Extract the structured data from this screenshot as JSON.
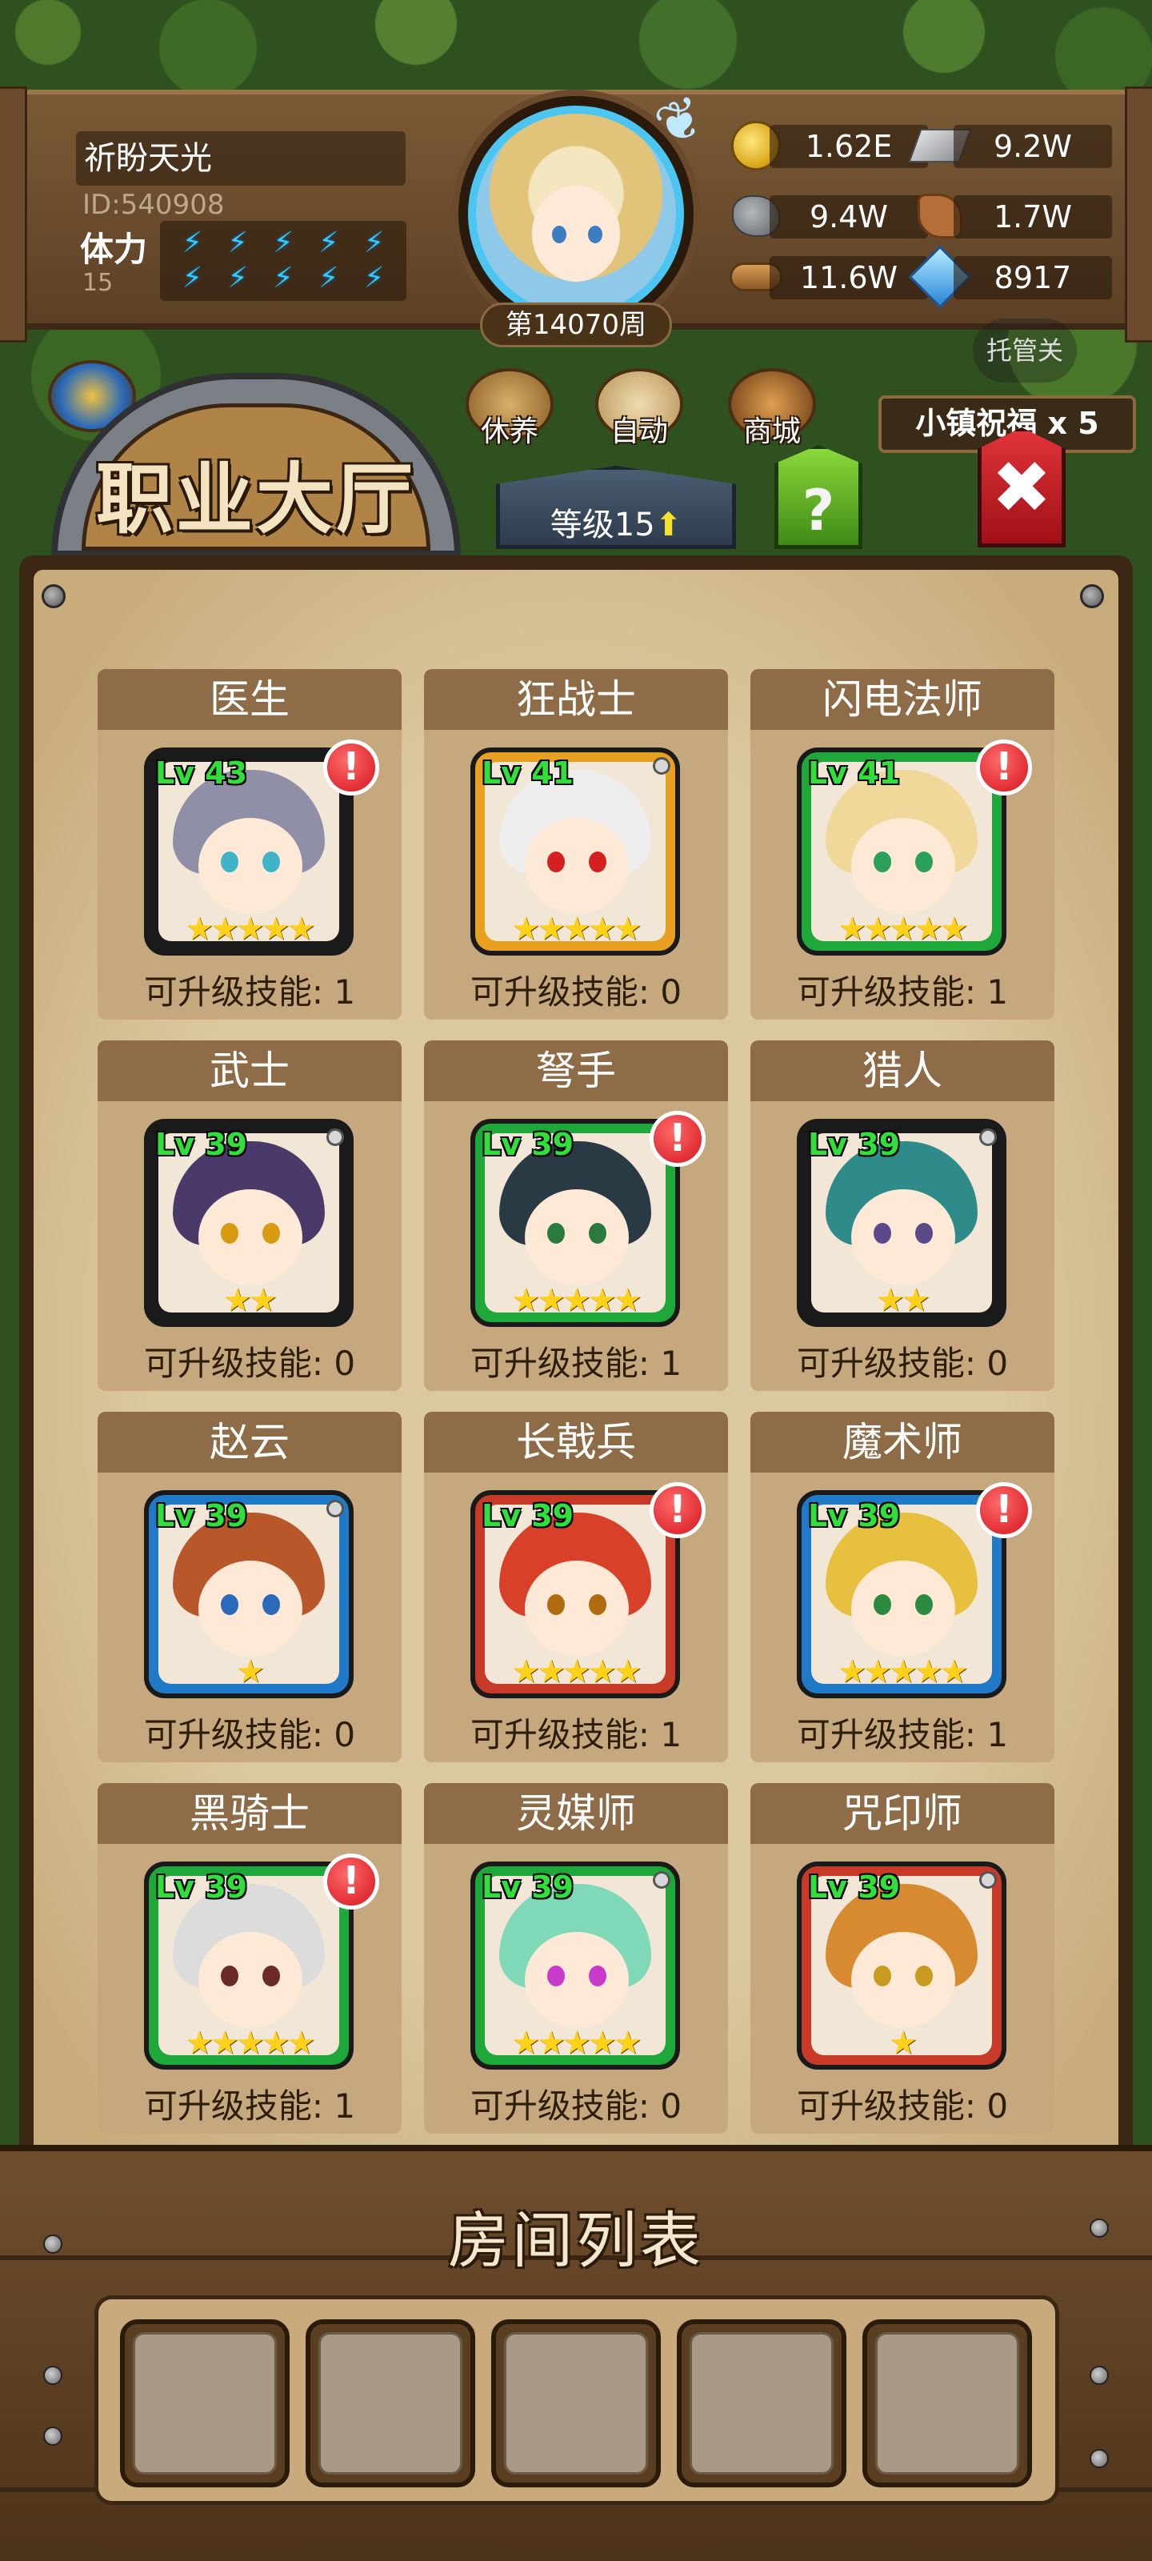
{
  "player": {
    "name": "祈盼天光",
    "id": "ID:540908",
    "stamina_label": "体力",
    "stamina_value": "15",
    "week": "第14070周"
  },
  "resources": [
    {
      "icon": "gold-coin-icon",
      "value": "1.62E"
    },
    {
      "icon": "iron-ingot-icon",
      "value": "9.2W"
    },
    {
      "icon": "ore-icon",
      "value": "9.4W"
    },
    {
      "icon": "leather-icon",
      "value": "1.7W"
    },
    {
      "icon": "wood-icon",
      "value": "11.6W"
    },
    {
      "icon": "crystal-icon",
      "value": "8917"
    }
  ],
  "auto_label": "托管关",
  "menu": {
    "rest": "休养",
    "auto": "自动",
    "shop": "商城"
  },
  "blessing": "小镇祝福 x 5",
  "hall": {
    "title": "职业大厅",
    "level_label": "等级15",
    "help": "?"
  },
  "skills_prefix": "可升级技能: ",
  "classes": [
    {
      "name": "医生",
      "level": "Lv 43",
      "stars": "★★★★★",
      "skills": "1",
      "alert": true,
      "frame": "#1a1a1a",
      "hair": "#8f8fa8",
      "eyes": "#3fb3c8"
    },
    {
      "name": "狂战士",
      "level": "Lv 41",
      "stars": "★★★★★",
      "skills": "0",
      "alert": false,
      "frame": "#e8a020",
      "hair": "#eeeeee",
      "eyes": "#d42020"
    },
    {
      "name": "闪电法师",
      "level": "Lv 41",
      "stars": "★★★★★",
      "skills": "1",
      "alert": true,
      "frame": "#1fa83a",
      "hair": "#f0d79a",
      "eyes": "#2aa05a"
    },
    {
      "name": "武士",
      "level": "Lv 39",
      "stars": "★★",
      "skills": "0",
      "alert": false,
      "frame": "#1a1a1a",
      "hair": "#4a3a6a",
      "eyes": "#d89a10"
    },
    {
      "name": "弩手",
      "level": "Lv 39",
      "stars": "★★★★★",
      "skills": "1",
      "alert": true,
      "frame": "#1fa83a",
      "hair": "#2a3a44",
      "eyes": "#2a7a40"
    },
    {
      "name": "猎人",
      "level": "Lv 39",
      "stars": "★★",
      "skills": "0",
      "alert": false,
      "frame": "#1a1a1a",
      "hair": "#2f8a8a",
      "eyes": "#5a4a8a"
    },
    {
      "name": "赵云",
      "level": "Lv 39",
      "stars": "★",
      "skills": "0",
      "alert": false,
      "frame": "#1f7ac8",
      "hair": "#b8582a",
      "eyes": "#2a6ab8"
    },
    {
      "name": "长戟兵",
      "level": "Lv 39",
      "stars": "★★★★★",
      "skills": "1",
      "alert": true,
      "frame": "#c83a28",
      "hair": "#d8402a",
      "eyes": "#b06a10"
    },
    {
      "name": "魔术师",
      "level": "Lv 39",
      "stars": "★★★★★",
      "skills": "1",
      "alert": true,
      "frame": "#1f7ac8",
      "hair": "#e8c040",
      "eyes": "#2a8a40"
    },
    {
      "name": "黑骑士",
      "level": "Lv 39",
      "stars": "★★★★★",
      "skills": "1",
      "alert": true,
      "frame": "#1fa83a",
      "hair": "#dcdcdc",
      "eyes": "#6a2a2a"
    },
    {
      "name": "灵媒师",
      "level": "Lv 39",
      "stars": "★★★★★",
      "skills": "0",
      "alert": false,
      "frame": "#1fa83a",
      "hair": "#7fd8b8",
      "eyes": "#c83ac8"
    },
    {
      "name": "咒印师",
      "level": "Lv 39",
      "stars": "★",
      "skills": "0",
      "alert": false,
      "frame": "#c83a28",
      "hair": "#d88a30",
      "eyes": "#c89a20"
    }
  ],
  "rooms": {
    "title": "房间列表",
    "slots": 5
  }
}
